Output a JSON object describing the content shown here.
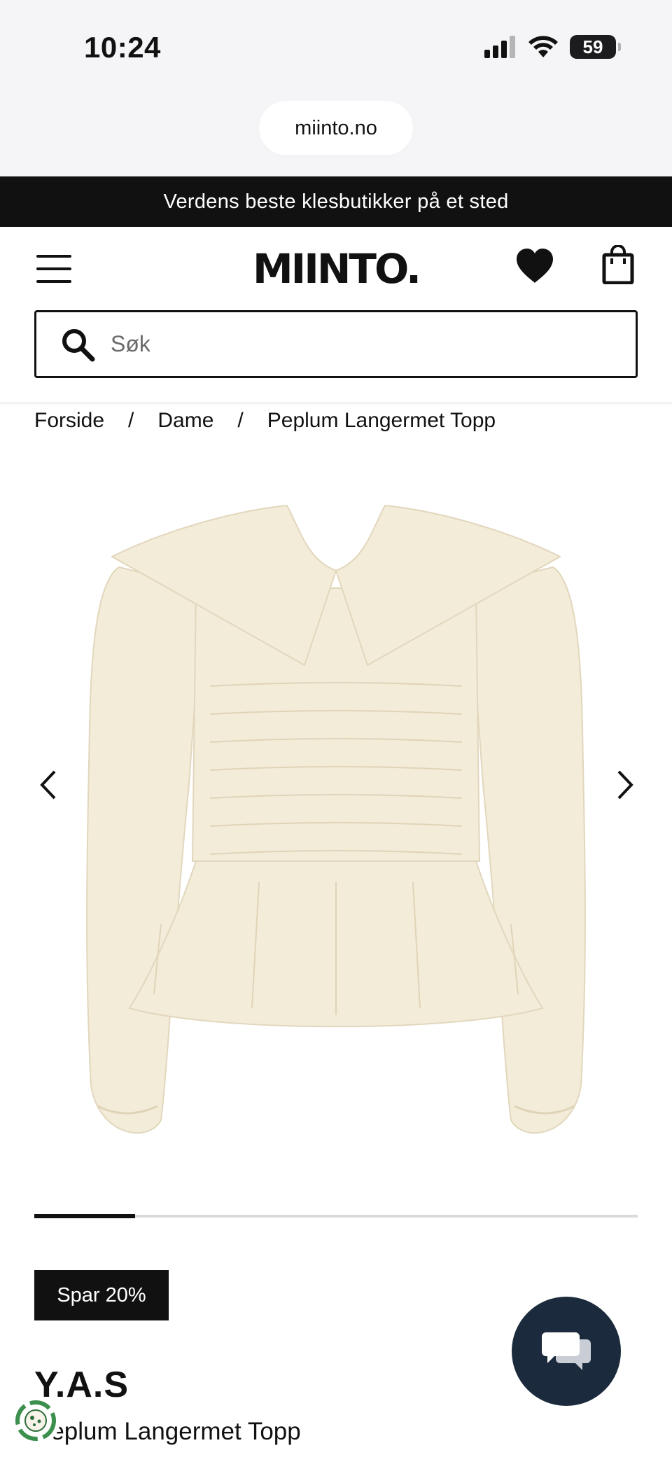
{
  "status_bar": {
    "time": "10:24",
    "battery": "59"
  },
  "browser": {
    "url": "miinto.no"
  },
  "promo": {
    "text": "Verdens beste klesbutikker på et sted"
  },
  "header": {
    "logo": "MIINTO."
  },
  "search": {
    "placeholder": "Søk"
  },
  "breadcrumb": {
    "items": [
      "Forside",
      "Dame",
      "Peplum Langermet Topp"
    ],
    "separator": "/"
  },
  "gallery": {
    "image_count": 6,
    "current_index": 1
  },
  "product": {
    "discount_badge": "Spar 20%",
    "brand": "Y.A.S",
    "name": "Peplum Langermet Topp"
  },
  "colors": {
    "primary": "#111111",
    "chat_button": "#1b2a3c",
    "promo_bg": "#111111",
    "garment": "#f3ecd9",
    "cookie_green": "#3c8f4d"
  }
}
